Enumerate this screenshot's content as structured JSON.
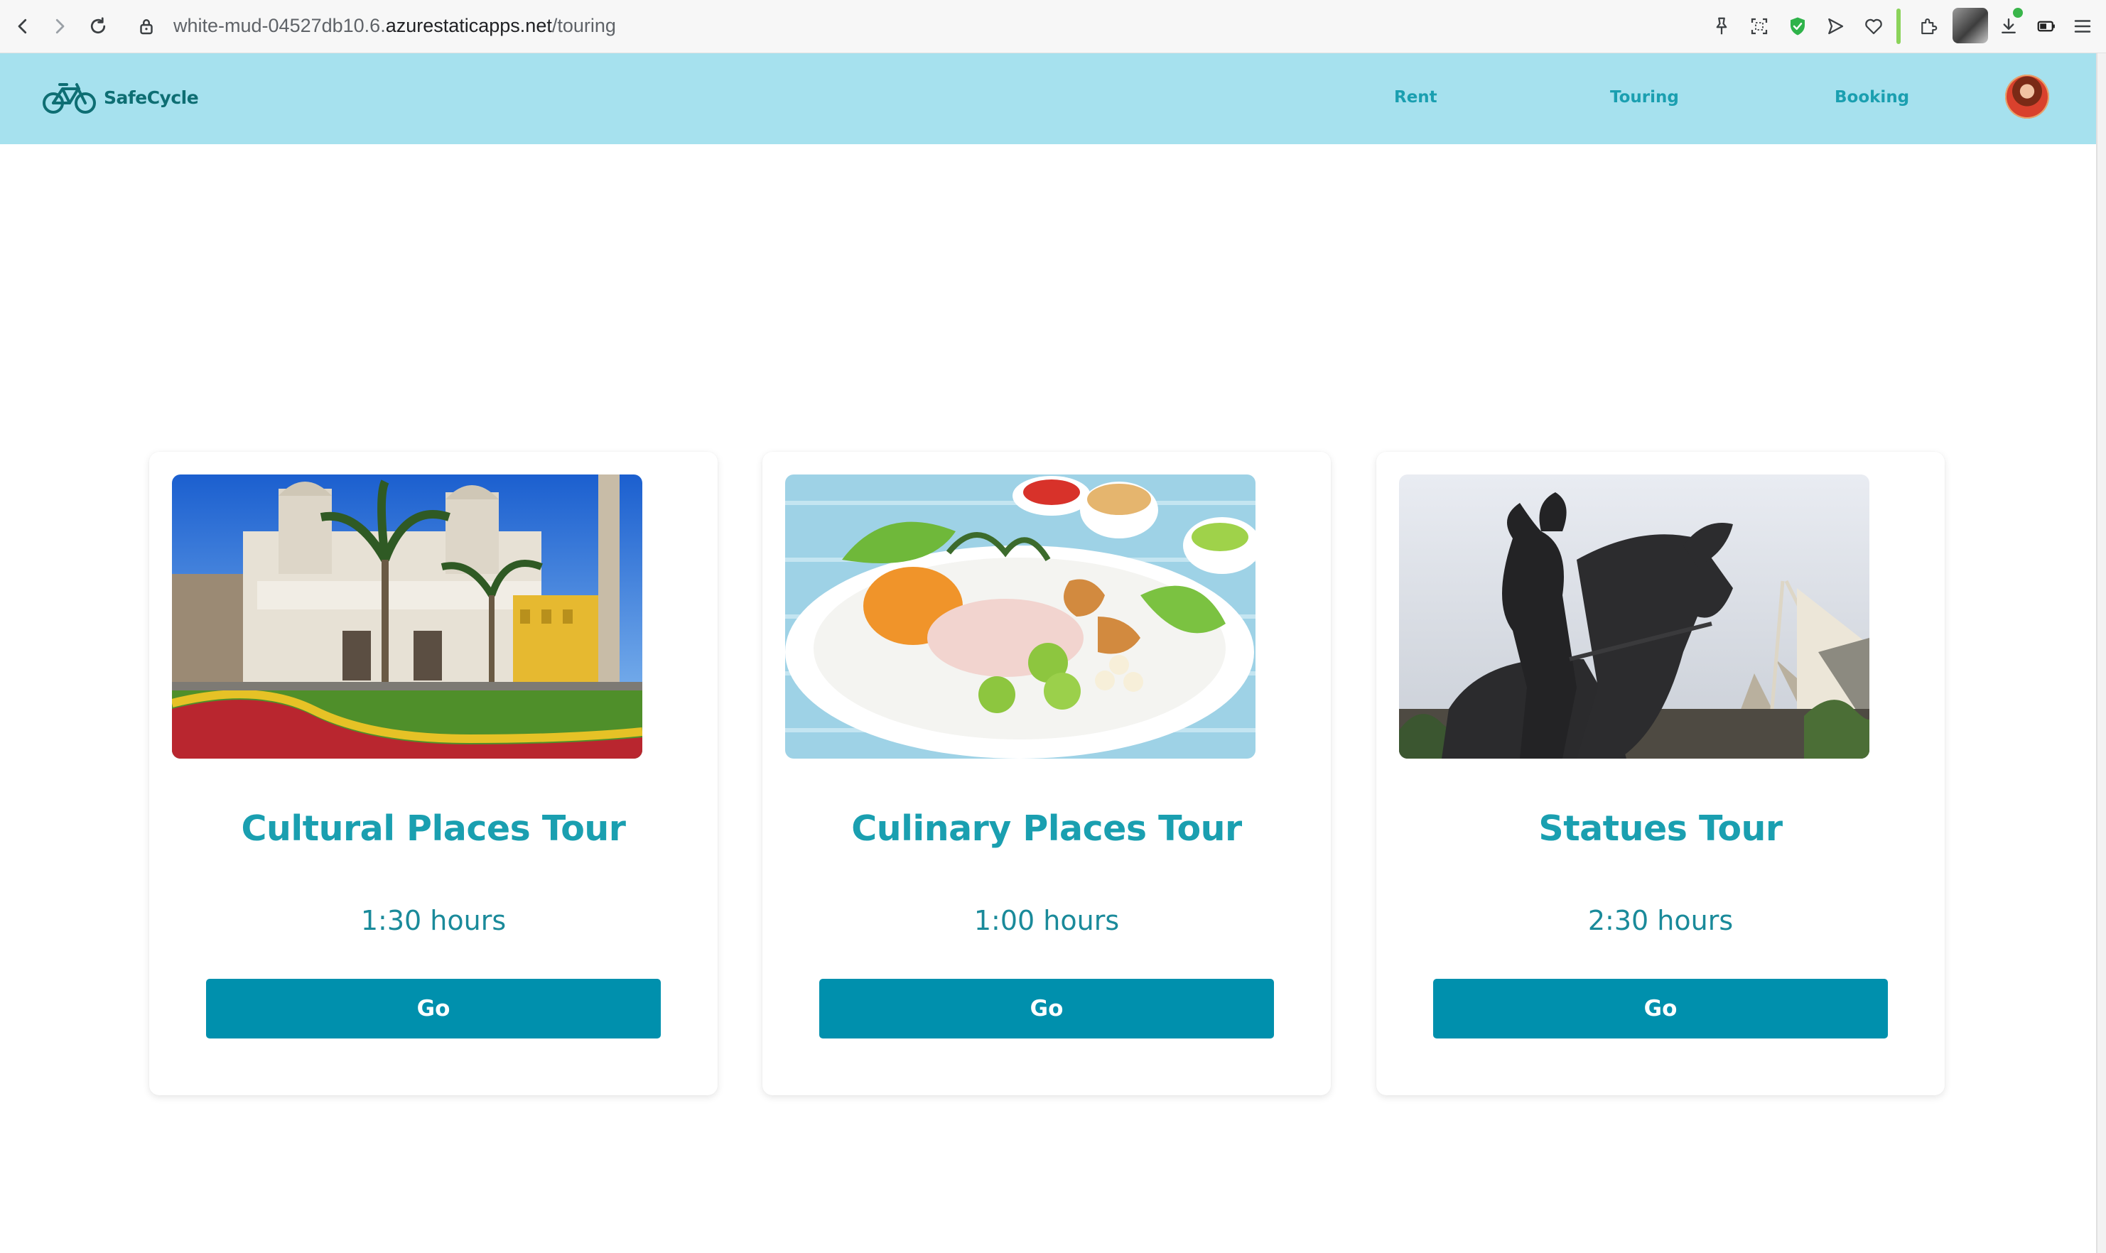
{
  "browser": {
    "url_prefix": "white-mud-04527db10.6.",
    "url_host": "azurestaticapps.net",
    "url_path": "/touring"
  },
  "app": {
    "brand": "SafeCycle",
    "nav": [
      {
        "label": "Rent"
      },
      {
        "label": "Touring"
      },
      {
        "label": "Booking"
      }
    ]
  },
  "tours": [
    {
      "title": "Cultural Places Tour",
      "duration": "1:30 hours",
      "button_label": "Go"
    },
    {
      "title": "Culinary Places Tour",
      "duration": "1:00 hours",
      "button_label": "Go"
    },
    {
      "title": "Statues Tour",
      "duration": "2:30 hours",
      "button_label": "Go"
    }
  ],
  "colors": {
    "header_bg": "#a6e1ee",
    "accent_teal": "#1a9fb0",
    "button_bg": "#0090ad",
    "brand_text": "#0e6e73"
  },
  "icons": {
    "back": "back-arrow-icon",
    "forward": "forward-arrow-icon",
    "reload": "reload-icon",
    "lock": "lock-icon",
    "logo": "bicycle-logo-icon"
  }
}
